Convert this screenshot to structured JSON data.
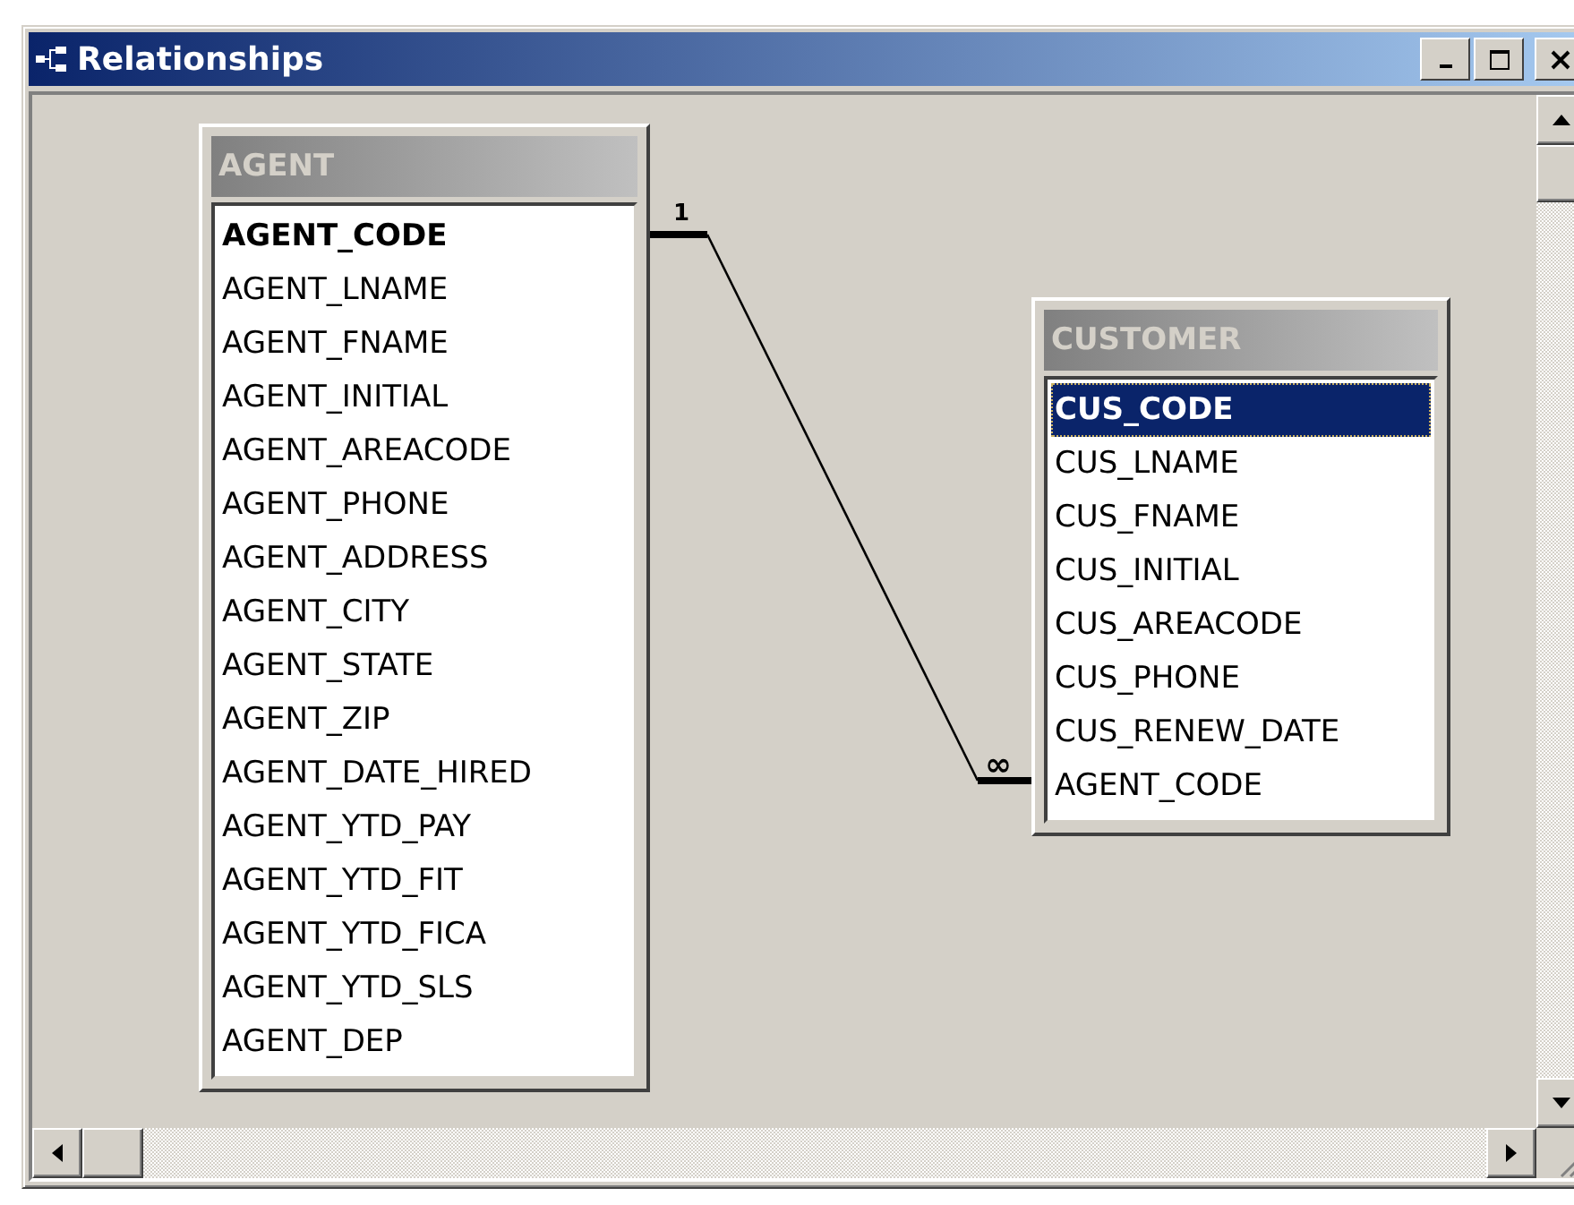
{
  "window": {
    "title": "Relationships"
  },
  "tables": [
    {
      "name": "AGENT",
      "fields": [
        {
          "name": "AGENT_CODE",
          "key": true,
          "selected": false
        },
        {
          "name": "AGENT_LNAME",
          "key": false,
          "selected": false
        },
        {
          "name": "AGENT_FNAME",
          "key": false,
          "selected": false
        },
        {
          "name": "AGENT_INITIAL",
          "key": false,
          "selected": false
        },
        {
          "name": "AGENT_AREACODE",
          "key": false,
          "selected": false
        },
        {
          "name": "AGENT_PHONE",
          "key": false,
          "selected": false
        },
        {
          "name": "AGENT_ADDRESS",
          "key": false,
          "selected": false
        },
        {
          "name": "AGENT_CITY",
          "key": false,
          "selected": false
        },
        {
          "name": "AGENT_STATE",
          "key": false,
          "selected": false
        },
        {
          "name": "AGENT_ZIP",
          "key": false,
          "selected": false
        },
        {
          "name": "AGENT_DATE_HIRED",
          "key": false,
          "selected": false
        },
        {
          "name": "AGENT_YTD_PAY",
          "key": false,
          "selected": false
        },
        {
          "name": "AGENT_YTD_FIT",
          "key": false,
          "selected": false
        },
        {
          "name": "AGENT_YTD_FICA",
          "key": false,
          "selected": false
        },
        {
          "name": "AGENT_YTD_SLS",
          "key": false,
          "selected": false
        },
        {
          "name": "AGENT_DEP",
          "key": false,
          "selected": false
        }
      ]
    },
    {
      "name": "CUSTOMER",
      "fields": [
        {
          "name": "CUS_CODE",
          "key": true,
          "selected": true
        },
        {
          "name": "CUS_LNAME",
          "key": false,
          "selected": false
        },
        {
          "name": "CUS_FNAME",
          "key": false,
          "selected": false
        },
        {
          "name": "CUS_INITIAL",
          "key": false,
          "selected": false
        },
        {
          "name": "CUS_AREACODE",
          "key": false,
          "selected": false
        },
        {
          "name": "CUS_PHONE",
          "key": false,
          "selected": false
        },
        {
          "name": "CUS_RENEW_DATE",
          "key": false,
          "selected": false
        },
        {
          "name": "AGENT_CODE",
          "key": false,
          "selected": false
        }
      ]
    }
  ],
  "relationship": {
    "one_label": "1",
    "many_label": "∞"
  }
}
